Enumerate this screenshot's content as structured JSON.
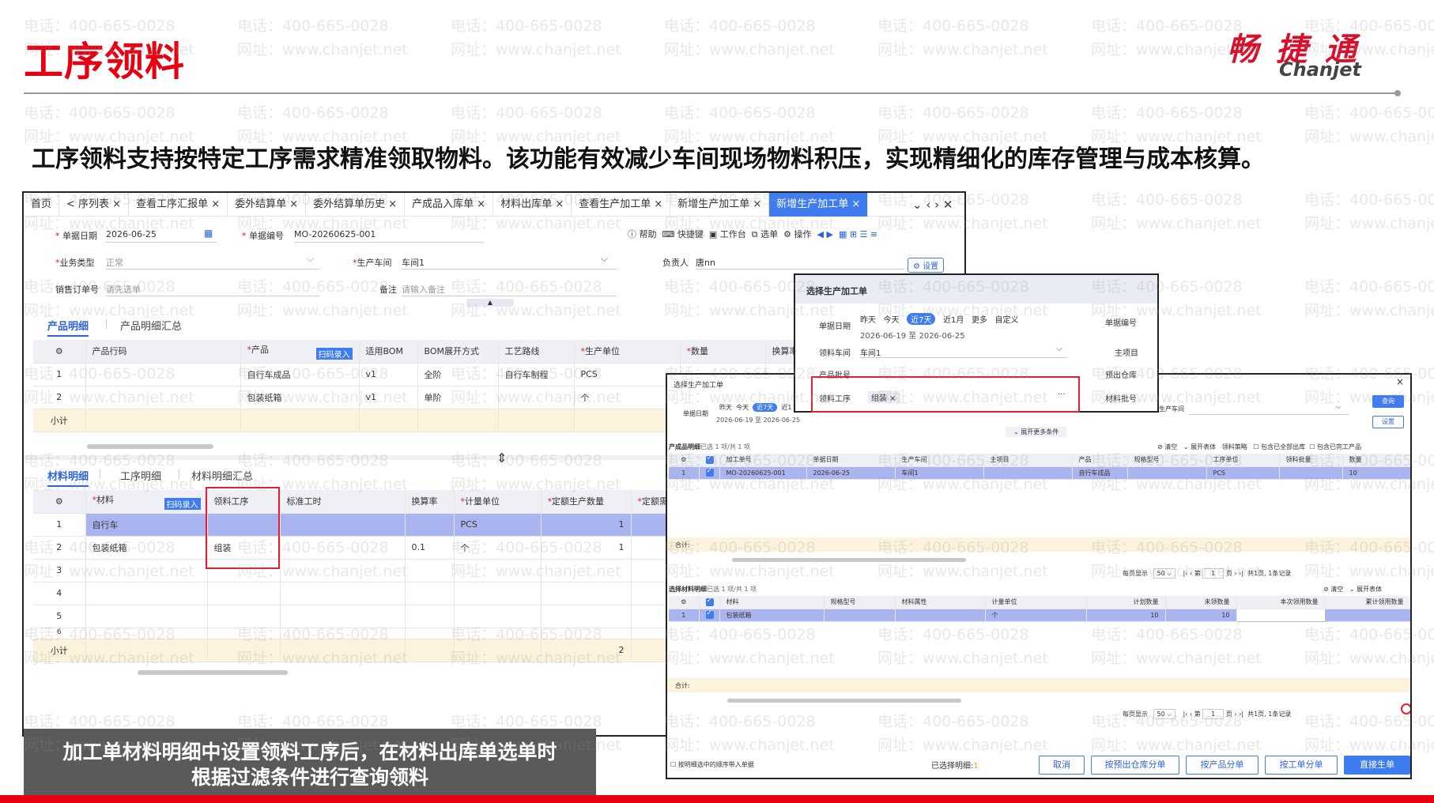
{
  "slide": {
    "title": "工序领料",
    "subtitle": "工序领料支持按特定工序需求精准领取物料。该功能有效减少车间现场物料积压，实现精细化的库存管理与成本核算。",
    "logo_cn": "畅 捷 通",
    "logo_en": "Chanjet",
    "caption_line1": "加工单材料明细中设置领料工序后，在材料出库单选单时",
    "caption_line2": "根据过滤条件进行查询领料",
    "watermark_phone": "电话：400-665-0028",
    "watermark_site": "网址：www.chanjet.net",
    "accent": "#e60012"
  },
  "main_window": {
    "tabs": [
      {
        "label": "首页"
      },
      {
        "label": "< 序列表 ×"
      },
      {
        "label": "查看工序汇报单 ×"
      },
      {
        "label": "委外结算单 ×"
      },
      {
        "label": "委外结算单历史 ×"
      },
      {
        "label": "产成品入库单 ×"
      },
      {
        "label": "材料出库单 ×"
      },
      {
        "label": "查看生产加工单 ×"
      },
      {
        "label": "新增生产加工单 ×"
      },
      {
        "label": "新增生产加工单 ×",
        "active": true
      }
    ],
    "toolbar": {
      "help": "帮助",
      "shortcut": "快捷键",
      "workbench": "工作台",
      "select": "选单",
      "operate": "操作",
      "settings": "设置"
    },
    "form": {
      "date_label": "单据日期",
      "date_value": "2026-06-25",
      "no_label": "单据编号",
      "no_value": "MO-20260625-001",
      "biztype_label": "业务类型",
      "biztype_value": "正常",
      "workshop_label": "生产车间",
      "workshop_value": "车间1",
      "owner_label": "负责人",
      "owner_value": "唐nn",
      "so_label": "销售订单号",
      "so_placeholder": "请先选单",
      "remark_label": "备注",
      "remark_placeholder": "请输入备注"
    },
    "product_tabs": [
      "产品明细",
      "产品明细汇总"
    ],
    "product_headers": [
      "产品行码",
      "产品",
      "适用BOM",
      "BOM展开方式",
      "工艺路线",
      "生产单位",
      "数量",
      "换算率"
    ],
    "scan_label": "扫码录入",
    "product_rows": [
      {
        "no": "1",
        "product": "自行车成品",
        "bom": "v1",
        "expand": "全阶",
        "route": "自行车制程",
        "unit": "PCS"
      },
      {
        "no": "2",
        "product": "包装纸箱",
        "bom": "v1",
        "expand": "单阶",
        "route": "",
        "unit": "个"
      }
    ],
    "subtotal": "小计",
    "material_tabs": [
      "材料明细",
      "工序明细",
      "材料明细汇总"
    ],
    "material_headers": [
      "材料",
      "领料工序",
      "标准工时",
      "换算率",
      "计量单位",
      "定额生产数量",
      "定额需"
    ],
    "material_rows": [
      {
        "no": "1",
        "material": "自行车",
        "process": "",
        "hours": "",
        "rate": "",
        "unit": "PCS",
        "qty": "1"
      },
      {
        "no": "2",
        "material": "包装纸箱",
        "process": "组装",
        "hours": "",
        "rate": "0.1",
        "unit": "个",
        "qty": "1"
      },
      {
        "no": "3"
      },
      {
        "no": "4"
      },
      {
        "no": "5"
      },
      {
        "no": "6"
      }
    ],
    "material_subtotal_qty": "2"
  },
  "filter_popup": {
    "title": "选择生产加工单",
    "date_label": "单据日期",
    "quick_dates": [
      "昨天",
      "今天",
      "近7天",
      "近1月",
      "更多",
      "自定义"
    ],
    "date_range": "2026-06-19 至 2026-06-25",
    "no_label": "单据编号",
    "workshop_label": "领料车间",
    "workshop_value": "车间1",
    "project_label": "主项目",
    "batch_label": "产品批号",
    "warehouse_label": "预出仓库",
    "process_label": "领料工序",
    "process_tag": "组装 ×",
    "mbatch_label": "材料批号"
  },
  "select_dialog": {
    "title": "选择生产加工单",
    "close": "×",
    "date_label": "单据日期",
    "quick_dates": [
      "昨天",
      "今天",
      "近7天",
      "近1"
    ],
    "date_range": "2026-06-19 至 2026-06-25",
    "workshop_label": "生产车间",
    "query_btn": "查询",
    "settings_btn": "设置",
    "expand_more": "展开更多条件",
    "product_title": "产成品明细",
    "product_selected": "已选 1 项/共 1 项",
    "product_actions": [
      "清空",
      "展开表体",
      "领料策略",
      "包含已全部出库",
      "包含已完工产品"
    ],
    "product_headers": [
      "加工单号",
      "单据日期",
      "生产车间",
      "主项目",
      "产品",
      "规格型号",
      "工序单位",
      "领料批量",
      "数量"
    ],
    "product_rows": [
      {
        "no": "1",
        "order": "MO-20260625-001",
        "date": "2026-06-25",
        "workshop": "车间1",
        "project": "",
        "product": "自行车成品",
        "spec": "",
        "unit": "PCS",
        "batch": "",
        "qty": "10"
      }
    ],
    "total_label": "合计:",
    "pager": {
      "per_page": "每页显示",
      "size": "50",
      "page_prefix": "第",
      "page": "1",
      "page_suffix": "页",
      "summary": "共1页, 1条记录"
    },
    "material_title": "选择材料明细",
    "material_selected": "已选 1 项/共 1 项",
    "material_actions": [
      "清空",
      "展开表体"
    ],
    "material_headers": [
      "材料",
      "规格型号",
      "材料属性",
      "计量单位",
      "计划数量",
      "未领数量",
      "本次领用数量",
      "累计领用数量"
    ],
    "material_rows": [
      {
        "no": "1",
        "material": "包装纸箱",
        "spec": "",
        "attr": "",
        "unit": "个",
        "plan": "10",
        "unreceived": "10",
        "current": "",
        "total": ""
      }
    ],
    "footer_check": "按明细选中的顺序带入单据",
    "selected_count_label": "已选择明细:",
    "selected_count": "1",
    "buttons": [
      "取消",
      "按预出仓库分单",
      "按产品分单",
      "按工单分单",
      "直接生单"
    ]
  }
}
